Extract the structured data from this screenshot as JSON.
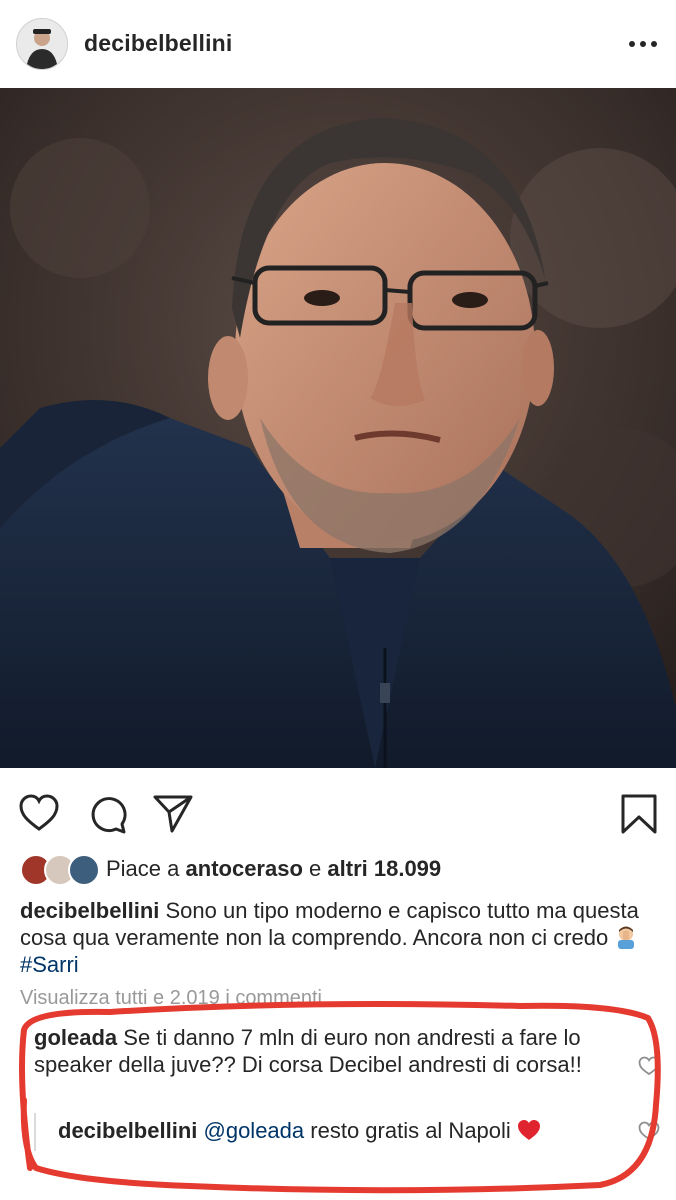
{
  "header": {
    "username": "decibelbellini",
    "more_icon": "more-horizontal-icon"
  },
  "photo": {
    "description_icon": "post-photo"
  },
  "actions": {
    "like_icon": "heart-icon",
    "comment_icon": "comment-icon",
    "share_icon": "paper-plane-icon",
    "save_icon": "bookmark-icon"
  },
  "likes": {
    "prefix": "Piace a",
    "user": "antoceraso",
    "connector": "e",
    "others": "altri 18.099"
  },
  "caption": {
    "username": "decibelbellini",
    "text": "Sono un tipo moderno e capisco tutto ma questa cosa qua veramente non la comprendo. Ancora non ci credo",
    "hashtag": "#Sarri"
  },
  "view_all": "Visualizza tutti e 2.019 i commenti",
  "comments": [
    {
      "username": "goleada",
      "text": "Se ti danno 7 mln di euro non andresti a fare lo speaker della juve?? Di corsa Decibel andresti di corsa!!"
    },
    {
      "username": "decibelbellini",
      "mention": "@goleada",
      "text": "resto gratis al Napoli"
    }
  ],
  "colors": {
    "text": "#262626",
    "link": "#003569",
    "muted": "#999999",
    "annotation_red": "#e53a2f"
  }
}
